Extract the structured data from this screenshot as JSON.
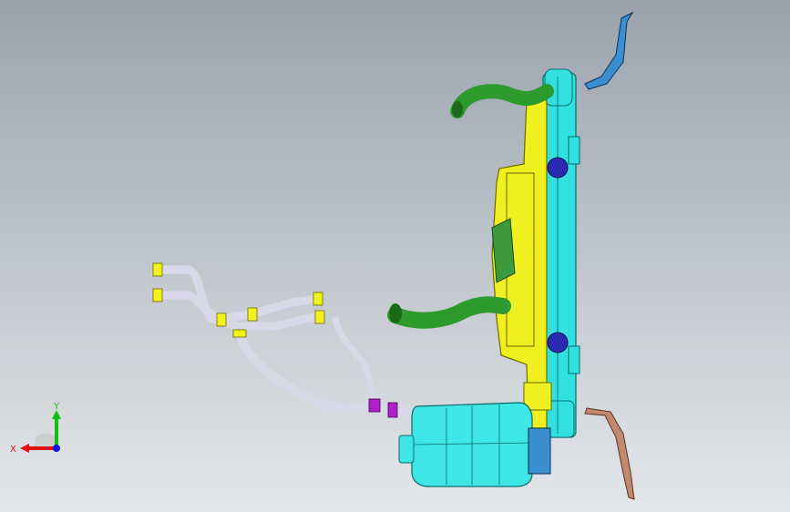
{
  "view": {
    "background_top": "#9aa3ad",
    "background_bottom": "#e4e7ea"
  },
  "parts": {
    "radiator": {
      "color": "#33e0e0"
    },
    "fan_shroud": {
      "color": "#f0f020"
    },
    "upper_hose": {
      "color": "#2d9a2d"
    },
    "lower_hose": {
      "color": "#2d9a2d"
    },
    "heater_pipes": {
      "color": "#d8d8e8"
    },
    "clamps": {
      "color": "#f2f21a"
    },
    "connector": {
      "color": "#b020c8"
    },
    "expansion_tank": {
      "color": "#3ee6e6"
    },
    "motor_bolts": {
      "color": "#2a2ab0"
    },
    "upper_bracket": {
      "color": "#3a8fd0"
    },
    "lower_bracket": {
      "color": "#c08a70"
    }
  },
  "triad": {
    "x_label": "X",
    "y_label": "Y",
    "x_color": "#e01010",
    "y_color": "#10c010",
    "z_color": "#1010e0"
  }
}
